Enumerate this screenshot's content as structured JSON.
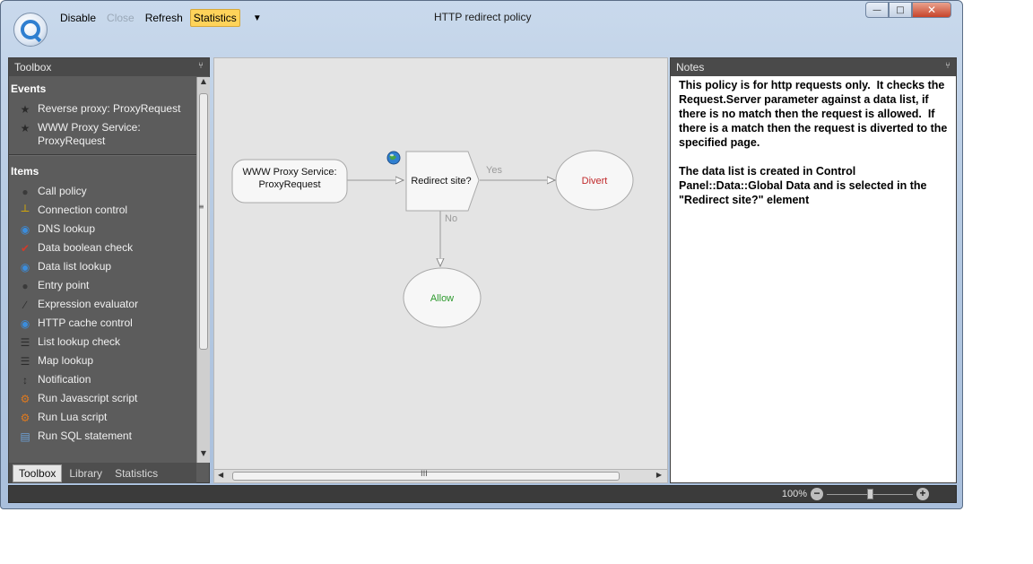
{
  "window": {
    "title": "HTTP redirect policy"
  },
  "toolbar": {
    "buttons": [
      {
        "label": "Disable",
        "state": "normal"
      },
      {
        "label": "Close",
        "state": "disabled"
      },
      {
        "label": "Refresh",
        "state": "normal"
      },
      {
        "label": "Statistics",
        "state": "active"
      }
    ]
  },
  "toolbox": {
    "title": "Toolbox",
    "events_title": "Events",
    "events": [
      {
        "label": "Reverse proxy: ProxyRequest",
        "icon": "star-icon"
      },
      {
        "label": "WWW Proxy Service: ProxyRequest",
        "icon": "star-icon"
      }
    ],
    "items_title": "Items",
    "items": [
      {
        "label": "Call policy",
        "icon": "circle-icon"
      },
      {
        "label": "Connection control",
        "icon": "plug-icon"
      },
      {
        "label": "DNS lookup",
        "icon": "globe-icon"
      },
      {
        "label": "Data boolean check",
        "icon": "checkmark-icon"
      },
      {
        "label": "Data list lookup",
        "icon": "globe-icon"
      },
      {
        "label": "Entry point",
        "icon": "circle-icon"
      },
      {
        "label": "Expression evaluator",
        "icon": "pen-icon"
      },
      {
        "label": "HTTP cache control",
        "icon": "globe-icon"
      },
      {
        "label": "List lookup check",
        "icon": "list-icon"
      },
      {
        "label": "Map lookup",
        "icon": "list-icon"
      },
      {
        "label": "Notification",
        "icon": "pin-icon"
      },
      {
        "label": "Run Javascript script",
        "icon": "gear-icon"
      },
      {
        "label": "Run Lua script",
        "icon": "gear-icon"
      },
      {
        "label": "Run SQL statement",
        "icon": "database-icon"
      }
    ],
    "tabs": [
      "Toolbox",
      "Library",
      "Statistics"
    ],
    "active_tab": "Toolbox"
  },
  "canvas": {
    "nodes": {
      "event": "WWW Proxy Service: ProxyRequest",
      "decision": "Redirect site?",
      "divert": "Divert",
      "allow": "Allow"
    },
    "edges": {
      "yes": "Yes",
      "no": "No"
    },
    "colors": {
      "divert": "#c0282a",
      "allow": "#2e9a2e"
    }
  },
  "notes": {
    "title": "Notes",
    "text": "This policy is for http requests only.  It checks the Request.Server parameter against a data list, if there is no match then the request is allowed.  If there is a match then the request is diverted to the specified page.\n\nThe data list is created in Control Panel::Data::Global Data and is selected in the \"Redirect site?\" element"
  },
  "status": {
    "zoom_label": "100%",
    "zoom_level": 1.0
  }
}
